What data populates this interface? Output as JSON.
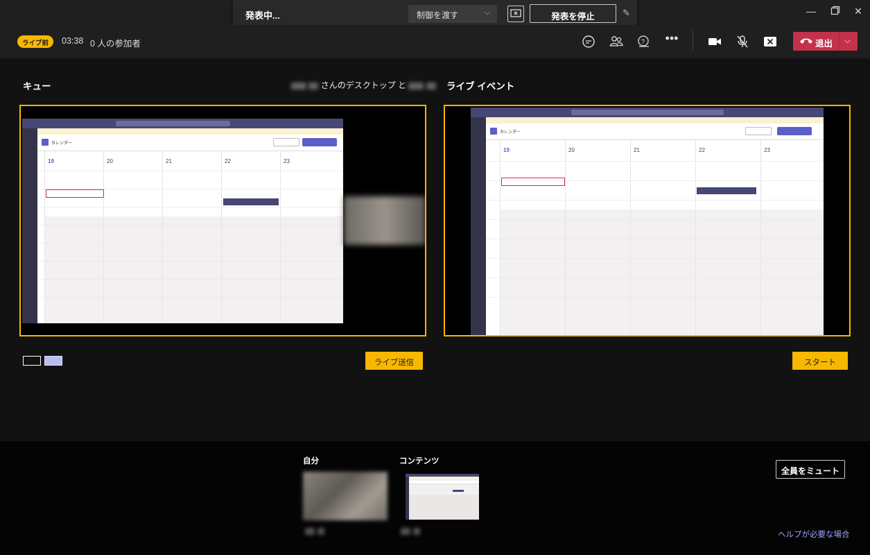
{
  "presentbar": {
    "status": "発表中...",
    "give_control": "制御を渡す",
    "stop_presenting": "発表を停止"
  },
  "header": {
    "badge": "ライブ前",
    "timer": "03:38",
    "participants": "0 人の参加者",
    "leave": "退出"
  },
  "queue": {
    "title": "キュー",
    "sharing_suffix": "さんのデスクトップ と",
    "send_live": "ライブ送信"
  },
  "live": {
    "title": "ライブ イベント",
    "start": "スタート"
  },
  "screen": {
    "calendar_title": "カレンダー",
    "days": [
      "19",
      "20",
      "21",
      "22",
      "23"
    ]
  },
  "bottom": {
    "self_label": "自分",
    "content_label": "コンテンツ",
    "mute_all": "全員をミュート",
    "help": "ヘルプが必要な場合"
  },
  "colors": {
    "accent_yellow": "#f8b700",
    "leave_red": "#c4314b",
    "teams_purple": "#464775",
    "link": "#9ea2ff"
  }
}
